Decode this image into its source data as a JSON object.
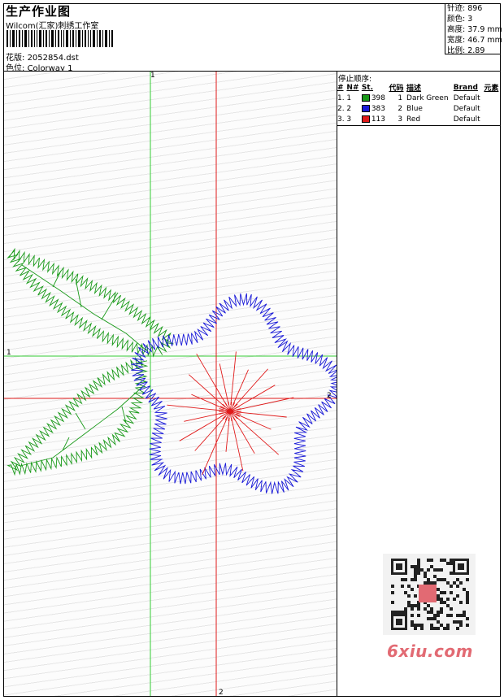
{
  "header": {
    "title": "生产作业图",
    "studio": "Wilcom(汇家)刺绣工作室",
    "design_label": "花版:",
    "design_value": "2052854.dst",
    "colorway_label": "色位:",
    "colorway_value": "Colorway 1"
  },
  "stats": {
    "stitches": "针迹: 896",
    "colors": "颜色: 3",
    "height": "高度: 37.9 mm",
    "width": "宽度: 46.7 mm",
    "ratio": "比例: 2.89"
  },
  "stop_sequence": {
    "title": "停止顺序:",
    "columns": [
      "#",
      "N#",
      "St.",
      "代码",
      "描述",
      "Brand",
      "元素"
    ],
    "rows": [
      {
        "idx": "1.",
        "n": "1",
        "color": "#1a9a1a",
        "st": "398",
        "code": "1",
        "desc": "Dark Green",
        "brand": "Default"
      },
      {
        "idx": "2.",
        "n": "2",
        "color": "#1a1ad8",
        "st": "383",
        "code": "2",
        "desc": "Blue",
        "brand": "Default"
      },
      {
        "idx": "3.",
        "n": "3",
        "color": "#e01a1a",
        "st": "113",
        "code": "3",
        "desc": "Red",
        "brand": "Default"
      }
    ]
  },
  "guides": {
    "v_green_label": "1",
    "h_green_label": "1",
    "v_red_label": "2",
    "h_red_label": "2"
  },
  "watermark": "6xiu.com",
  "colors": {
    "green": "#1a9a1a",
    "blue": "#1a1ad8",
    "red": "#e01a1a",
    "guide_green": "#33cc33",
    "guide_red": "#e01a1a"
  }
}
